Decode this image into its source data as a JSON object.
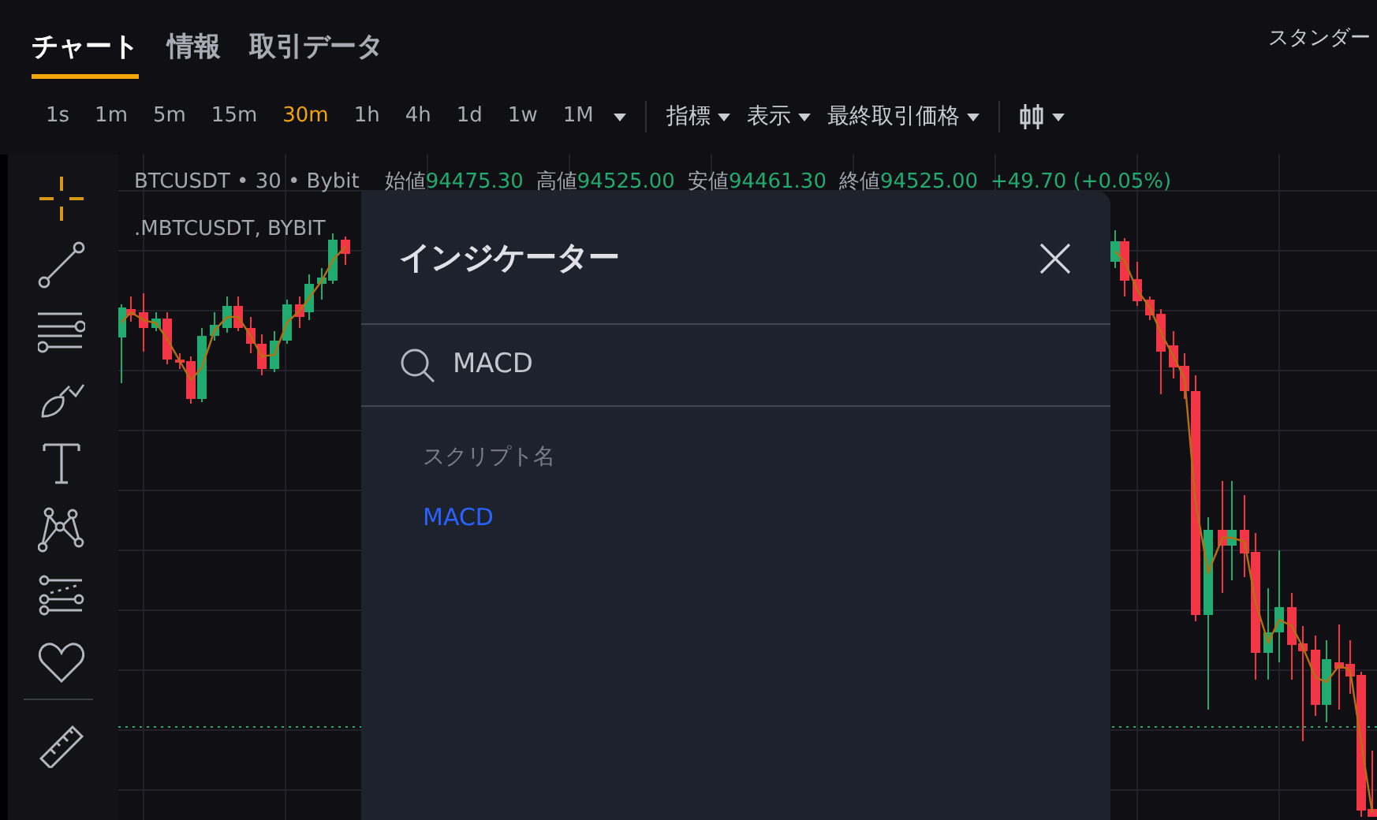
{
  "tabs": [
    {
      "label": "チャート",
      "selected": true
    },
    {
      "label": "情報",
      "selected": false
    },
    {
      "label": "取引データ",
      "selected": false
    }
  ],
  "header_right": "スタンダー",
  "timeframes": [
    {
      "label": "1s",
      "selected": false
    },
    {
      "label": "1m",
      "selected": false
    },
    {
      "label": "5m",
      "selected": false
    },
    {
      "label": "15m",
      "selected": false
    },
    {
      "label": "30m",
      "selected": true
    },
    {
      "label": "1h",
      "selected": false
    },
    {
      "label": "4h",
      "selected": false
    },
    {
      "label": "1d",
      "selected": false
    },
    {
      "label": "1w",
      "selected": false
    },
    {
      "label": "1M",
      "selected": false
    }
  ],
  "menus": [
    "指標",
    "表示",
    "最終取引価格"
  ],
  "tools": [
    {
      "selected": true
    },
    {
      "selected": false
    },
    {
      "selected": false
    },
    {
      "selected": false
    },
    {
      "selected": false
    },
    {
      "selected": false
    },
    {
      "selected": false
    },
    {
      "selected": false
    },
    {
      "selected": false
    }
  ],
  "legend": {
    "symbol": "BTCUSDT • 30 • Bybit",
    "ohlc": [
      {
        "label": "始値",
        "value": "94475.30"
      },
      {
        "label": "高値",
        "value": "94525.00"
      },
      {
        "label": "安値",
        "value": "94461.30"
      },
      {
        "label": "終値",
        "value": "94525.00"
      }
    ],
    "change": "+49.70 (+0.05%)",
    "study": ".MBTCUSDT, BYBIT"
  },
  "dialog": {
    "title": "インジケーター",
    "search": {
      "value": "MACD"
    },
    "section": "スクリプト名",
    "results": [
      "MACD"
    ]
  }
}
